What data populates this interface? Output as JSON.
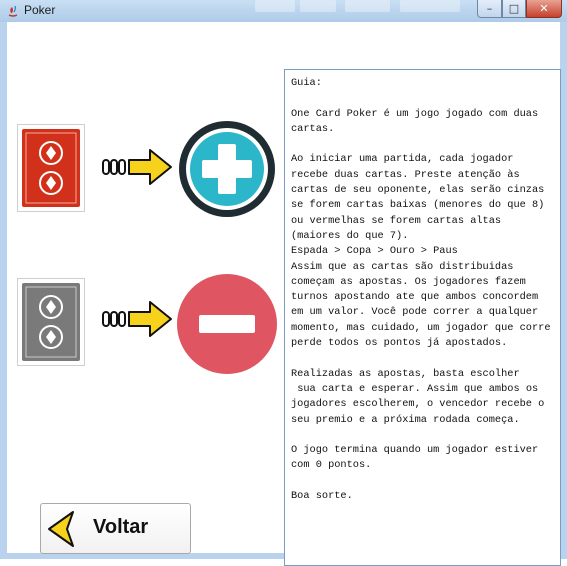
{
  "window": {
    "title": "Poker",
    "controls": {
      "minimize": "–",
      "maximize": "□",
      "close": "✕"
    }
  },
  "legend": {
    "high_card": {
      "color": "#d1311a",
      "icon": "plus-circle-icon",
      "icon_color": "#2bb7c9"
    },
    "low_card": {
      "color": "#7a7a7a",
      "icon": "minus-circle-icon",
      "icon_color": "#e05562"
    }
  },
  "guide": {
    "text": "Guia:\n\nOne Card Poker é um jogo jogado com duas cartas.\n\nAo iniciar uma partida, cada jogador recebe duas cartas. Preste atenção às cartas de seu oponente, elas serão cinzas se forem cartas baixas (menores do que 8) ou vermelhas se forem cartas altas (maiores do que 7).\nEspada > Copa > Ouro > Paus\nAssim que as cartas são distribuidas começam as apostas. Os jogadores fazem turnos apostando ate que ambos concordem em um valor. Você pode correr a qualquer momento, mas cuidado, um jogador que corre perde todos os pontos já apostados.\n\nRealizadas as apostas, basta escolher\n sua carta e esperar. Assim que ambos os jogadores escolherem, o vencedor recebe o seu premio e a próxima rodada começa.\n\nO jogo termina quando um jogador estiver com 0 pontos.\n\nBoa sorte."
  },
  "buttons": {
    "back": {
      "label": "Voltar",
      "icon": "back-arrow-icon"
    }
  }
}
